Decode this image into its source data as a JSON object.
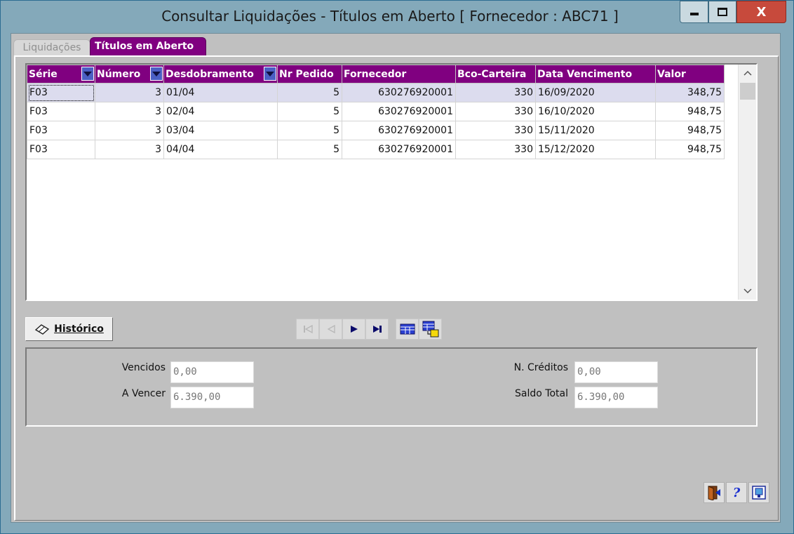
{
  "window": {
    "title": "Consultar Liquidações - Títulos em Aberto [ Fornecedor : ABC71 ]",
    "minimize_glyph": "—",
    "maximize_glyph": "□",
    "close_glyph": "X"
  },
  "tabs": [
    {
      "label": "Liquidações",
      "active": false
    },
    {
      "label": "Títulos em Aberto",
      "active": true
    }
  ],
  "grid": {
    "columns": [
      "Série",
      "Número",
      "Desdobramento",
      "Nr Pedido",
      "Fornecedor",
      "Bco-Carteira",
      "Data Vencimento",
      "Valor"
    ],
    "rows": [
      {
        "serie": "F03",
        "numero": "3",
        "desdobramento": "01/04",
        "nr_pedido": "5",
        "fornecedor": "630276920001",
        "bco_carteira": "330",
        "data_vencimento": "16/09/2020",
        "valor": "348,75"
      },
      {
        "serie": "F03",
        "numero": "3",
        "desdobramento": "02/04",
        "nr_pedido": "5",
        "fornecedor": "630276920001",
        "bco_carteira": "330",
        "data_vencimento": "16/10/2020",
        "valor": "948,75"
      },
      {
        "serie": "F03",
        "numero": "3",
        "desdobramento": "03/04",
        "nr_pedido": "5",
        "fornecedor": "630276920001",
        "bco_carteira": "330",
        "data_vencimento": "15/11/2020",
        "valor": "948,75"
      },
      {
        "serie": "F03",
        "numero": "3",
        "desdobramento": "04/04",
        "nr_pedido": "5",
        "fornecedor": "630276920001",
        "bco_carteira": "330",
        "data_vencimento": "15/12/2020",
        "valor": "948,75"
      }
    ],
    "selected_row": 0
  },
  "buttons": {
    "historico": "Histórico"
  },
  "summary": {
    "vencidos_label": "Vencidos",
    "vencidos_value": "0,00",
    "a_vencer_label": "A Vencer",
    "a_vencer_value": "6.390,00",
    "n_creditos_label": "N. Créditos",
    "n_creditos_value": "0,00",
    "saldo_total_label": "Saldo Total",
    "saldo_total_value": "6.390,00"
  },
  "colors": {
    "header_bg": "#800080",
    "window_frame": "#84a9ba",
    "panel_bg": "#c0c0c0"
  }
}
